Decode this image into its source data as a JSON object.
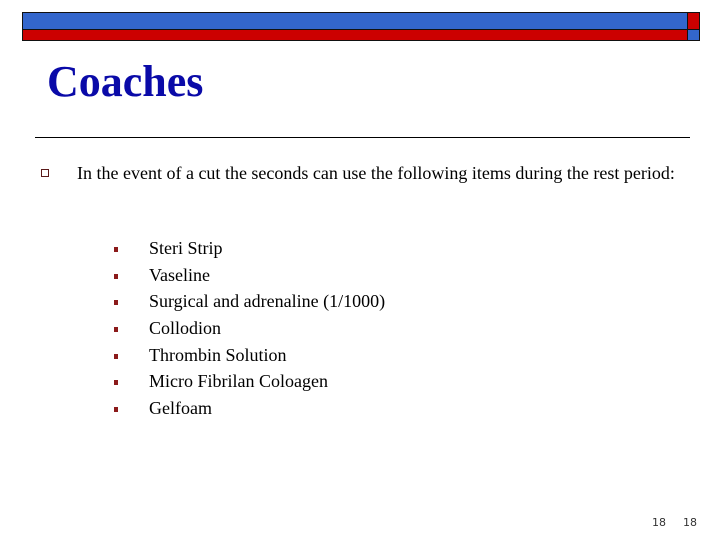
{
  "slide": {
    "title": "Coaches",
    "main_bullet": {
      "text": "In the event of a cut the seconds can use the following items during the rest period:"
    },
    "sub_bullets": [
      "Steri Strip",
      "Vaseline",
      "Surgical and adrenaline (1/1000)",
      "Collodion",
      "Thrombin Solution",
      "Micro Fibrilan Coloagen",
      "Gelfoam"
    ],
    "page_numbers": [
      "18",
      "18"
    ]
  },
  "theme": {
    "title_color": "#0a0aa8",
    "bar_blue": "#3366cc",
    "bar_red": "#cc0000",
    "bullet_color": "#8b1a1a"
  }
}
